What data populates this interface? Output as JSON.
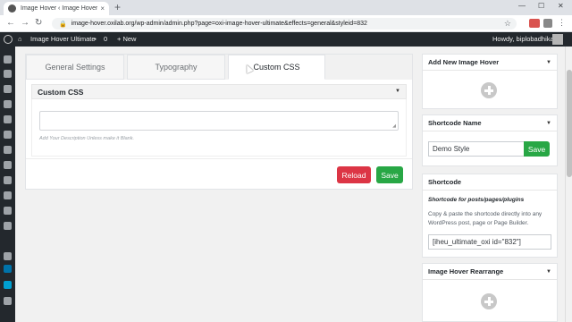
{
  "browser": {
    "tab_title": "Image Hover ‹ Image Hover Ultim...",
    "tab_close": "×",
    "new_tab": "+",
    "url": "image-hover.oxilab.org/wp-admin/admin.php?page=oxi-image-hover-ultimate&effects=general&styleid=832",
    "minimize": "—",
    "maximize": "☐",
    "close": "✕"
  },
  "adminbar": {
    "site_name": "Image Hover Ultimate",
    "comments_count": "0",
    "new_label": "+ New",
    "howdy": "Howdy, biplobadhikari"
  },
  "main": {
    "tabs": [
      {
        "label": "General Settings"
      },
      {
        "label": "Typography"
      },
      {
        "label": "Custom CSS"
      }
    ],
    "section_title": "Custom CSS",
    "description_hint": "Add Your Description Unless make it Blank.",
    "reload_label": "Reload",
    "save_label": "Save"
  },
  "right": {
    "add_new": {
      "title": "Add New Image Hover"
    },
    "shortcode_name": {
      "title": "Shortcode Name",
      "value": "Demo Style",
      "save_label": "Save"
    },
    "shortcode": {
      "title": "Shortcode",
      "subtitle": "Shortcode for posts/pages/plugins",
      "description": "Copy & paste the shortcode directly into any WordPress post, page or Page Builder.",
      "value": "[iheu_ultimate_oxi id=\"832\"]"
    },
    "rearrange": {
      "title": "Image Hover Rearrange"
    }
  },
  "colors": {
    "adminbar_bg": "#23282d",
    "accent_blue": "#0073aa",
    "save_green": "#28a745",
    "reload_red": "#dc3545"
  }
}
